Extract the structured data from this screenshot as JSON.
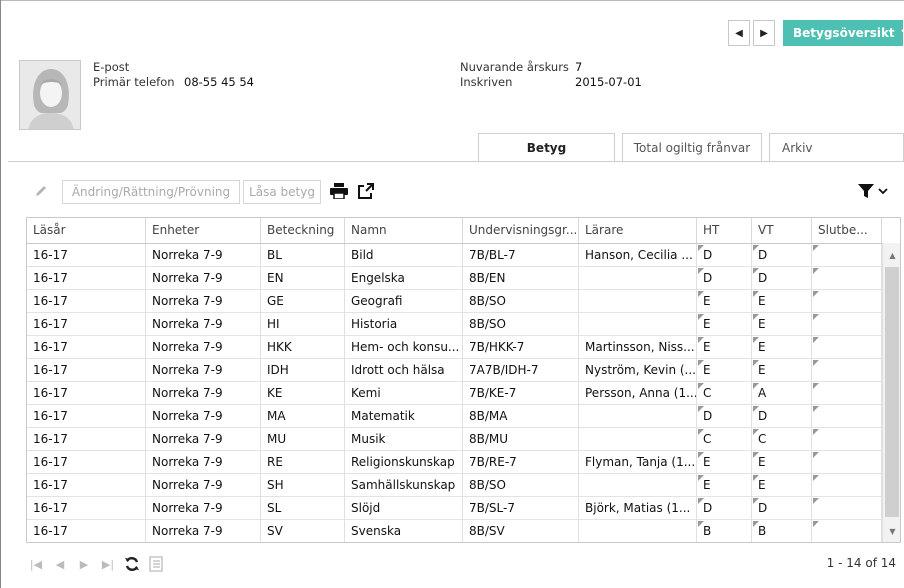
{
  "nav": {
    "overview_label": "Betygsöversikt"
  },
  "student": {
    "email_label": "E-post",
    "phone_label": "Primär telefon",
    "phone_value": "08-55 45 54",
    "grade_label": "Nuvarande årskurs",
    "grade_value": "7",
    "enrolled_label": "Inskriven",
    "enrolled_value": "2015-07-01"
  },
  "tabs": [
    {
      "label": "Betyg",
      "active": true
    },
    {
      "label": "Total ogiltig frånvar",
      "active": false
    },
    {
      "label": "Arkiv",
      "active": false
    }
  ],
  "toolbar": {
    "change_label": "Ändring/Rättning/Prövning",
    "lock_label": "Låsa betyg"
  },
  "grid": {
    "columns": [
      "Läsår",
      "Enheter",
      "Beteckning",
      "Namn",
      "Undervisningsgr...",
      "Lärare",
      "HT",
      "VT",
      "Slutbe..."
    ],
    "rows": [
      [
        "16-17",
        "Norreka 7-9",
        "BL",
        "Bild",
        "7B/BL-7",
        "Hanson, Cecilia ...",
        "D",
        "D",
        ""
      ],
      [
        "16-17",
        "Norreka 7-9",
        "EN",
        "Engelska",
        "8B/EN",
        "",
        "D",
        "D",
        ""
      ],
      [
        "16-17",
        "Norreka 7-9",
        "GE",
        "Geografi",
        "8B/SO",
        "",
        "E",
        "E",
        ""
      ],
      [
        "16-17",
        "Norreka 7-9",
        "HI",
        "Historia",
        "8B/SO",
        "",
        "E",
        "E",
        ""
      ],
      [
        "16-17",
        "Norreka 7-9",
        "HKK",
        "Hem- och konsu...",
        "7B/HKK-7",
        "Martinsson, Niss...",
        "E",
        "E",
        ""
      ],
      [
        "16-17",
        "Norreka 7-9",
        "IDH",
        "Idrott och hälsa",
        "7A7B/IDH-7",
        "Nyström, Kevin (...",
        "E",
        "E",
        ""
      ],
      [
        "16-17",
        "Norreka 7-9",
        "KE",
        "Kemi",
        "7B/KE-7",
        "Persson, Anna (1...",
        "C",
        "A",
        ""
      ],
      [
        "16-17",
        "Norreka 7-9",
        "MA",
        "Matematik",
        "8B/MA",
        "",
        "D",
        "D",
        ""
      ],
      [
        "16-17",
        "Norreka 7-9",
        "MU",
        "Musik",
        "8B/MU",
        "",
        "C",
        "C",
        ""
      ],
      [
        "16-17",
        "Norreka 7-9",
        "RE",
        "Religionskunskap",
        "7B/RE-7",
        "Flyman, Tanja (1...",
        "E",
        "E",
        ""
      ],
      [
        "16-17",
        "Norreka 7-9",
        "SH",
        "Samhällskunskap",
        "8B/SO",
        "",
        "E",
        "E",
        ""
      ],
      [
        "16-17",
        "Norreka 7-9",
        "SL",
        "Slöjd",
        "7B/SL-7",
        "Björk, Matias (1...",
        "D",
        "D",
        ""
      ],
      [
        "16-17",
        "Norreka 7-9",
        "SV",
        "Svenska",
        "8B/SV",
        "",
        "B",
        "B",
        ""
      ]
    ]
  },
  "pager": {
    "info": "1 - 14 of 14"
  },
  "icons": {
    "nav_prev": "arrow-left-icon",
    "nav_next": "arrow-right-icon",
    "edit": "pencil-icon",
    "print": "printer-icon",
    "export": "export-icon",
    "filter": "filter-icon",
    "refresh": "refresh-icon"
  },
  "colors": {
    "accent": "#4dbfb3"
  }
}
